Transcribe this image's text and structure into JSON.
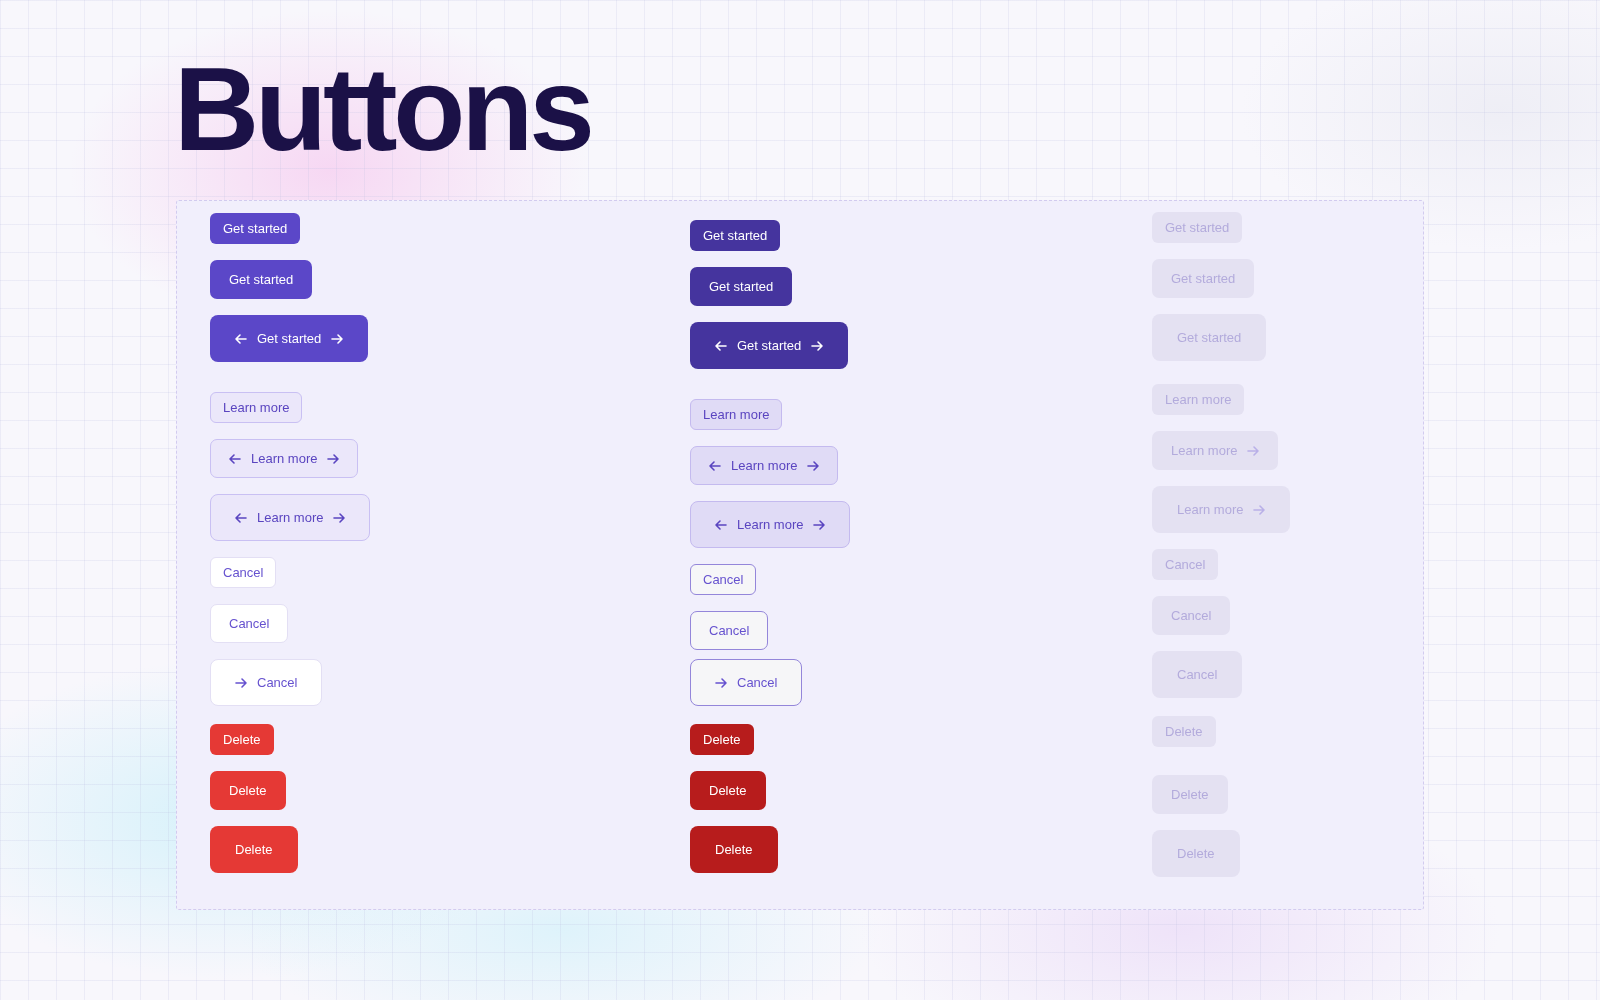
{
  "title": "Buttons",
  "columns": [
    {
      "hovered": false,
      "disabled": false,
      "groups": [
        {
          "kind": "primary",
          "buttons": [
            {
              "kind": "small",
              "label": "Get started",
              "left_arrow_before": false,
              "right_arrow_before": false,
              "right_arrow_after": false
            },
            {
              "kind": "medium",
              "label": "Get started",
              "left_arrow_before": false,
              "right_arrow_before": false,
              "right_arrow_after": false
            },
            {
              "kind": "large",
              "label": "Get started",
              "left_arrow_before": true,
              "right_arrow_before": false,
              "right_arrow_after": true
            }
          ]
        },
        {
          "kind": "secondary",
          "buttons": [
            {
              "kind": "small",
              "label": "Learn more",
              "left_arrow_before": false,
              "right_arrow_before": false,
              "right_arrow_after": false
            },
            {
              "kind": "medium",
              "label": "Learn more",
              "left_arrow_before": true,
              "right_arrow_before": false,
              "right_arrow_after": true
            },
            {
              "kind": "large",
              "label": "Learn more",
              "left_arrow_before": true,
              "right_arrow_before": false,
              "right_arrow_after": true
            }
          ]
        },
        {
          "kind": "outline",
          "buttons": [
            {
              "kind": "small",
              "label": "Cancel",
              "left_arrow_before": false,
              "right_arrow_before": false,
              "right_arrow_after": false
            },
            {
              "kind": "medium",
              "label": "Cancel",
              "left_arrow_before": false,
              "right_arrow_before": false,
              "right_arrow_after": false
            },
            {
              "kind": "large",
              "label": "Cancel",
              "left_arrow_before": false,
              "right_arrow_before": true,
              "right_arrow_after": false
            }
          ]
        },
        {
          "kind": "danger",
          "buttons": [
            {
              "kind": "small",
              "label": "Delete",
              "left_arrow_before": false,
              "right_arrow_before": false,
              "right_arrow_after": false
            },
            {
              "kind": "medium",
              "label": "Delete",
              "left_arrow_before": false,
              "right_arrow_before": false,
              "right_arrow_after": false
            },
            {
              "kind": "large",
              "label": "Delete",
              "left_arrow_before": false,
              "right_arrow_before": false,
              "right_arrow_after": false
            }
          ]
        }
      ]
    },
    {
      "hovered": true,
      "disabled": false,
      "groups": [
        {
          "kind": "primary",
          "buttons": [
            {
              "kind": "small",
              "label": "Get started",
              "left_arrow_before": false,
              "right_arrow_before": false,
              "right_arrow_after": false
            },
            {
              "kind": "medium",
              "label": "Get started",
              "left_arrow_before": false,
              "right_arrow_before": false,
              "right_arrow_after": false
            },
            {
              "kind": "large",
              "label": "Get started",
              "left_arrow_before": true,
              "right_arrow_before": false,
              "right_arrow_after": true
            }
          ]
        },
        {
          "kind": "secondary",
          "buttons": [
            {
              "kind": "small",
              "label": "Learn more",
              "left_arrow_before": false,
              "right_arrow_before": false,
              "right_arrow_after": false
            },
            {
              "kind": "medium",
              "label": "Learn more",
              "left_arrow_before": true,
              "right_arrow_before": false,
              "right_arrow_after": true
            },
            {
              "kind": "large",
              "label": "Learn more",
              "left_arrow_before": true,
              "right_arrow_before": false,
              "right_arrow_after": true
            }
          ]
        },
        {
          "kind": "outline",
          "buttons": [
            {
              "kind": "small",
              "label": "Cancel",
              "left_arrow_before": false,
              "right_arrow_before": false,
              "right_arrow_after": false
            },
            {
              "kind": "medium",
              "label": "Cancel",
              "left_arrow_before": false,
              "right_arrow_before": false,
              "right_arrow_after": false
            },
            {
              "kind": "large",
              "label": "Cancel",
              "left_arrow_before": false,
              "right_arrow_before": true,
              "right_arrow_after": false
            }
          ]
        },
        {
          "kind": "danger",
          "buttons": [
            {
              "kind": "small",
              "label": "Delete",
              "left_arrow_before": false,
              "right_arrow_before": false,
              "right_arrow_after": false
            },
            {
              "kind": "medium",
              "label": "Delete",
              "left_arrow_before": false,
              "right_arrow_before": false,
              "right_arrow_after": false
            },
            {
              "kind": "large",
              "label": "Delete",
              "left_arrow_before": false,
              "right_arrow_before": false,
              "right_arrow_after": false
            }
          ]
        }
      ]
    },
    {
      "hovered": false,
      "disabled": true,
      "groups": [
        {
          "kind": "primary",
          "buttons": [
            {
              "kind": "small",
              "label": "Get started",
              "left_arrow_before": false,
              "right_arrow_before": false,
              "right_arrow_after": false
            },
            {
              "kind": "medium",
              "label": "Get started",
              "left_arrow_before": false,
              "right_arrow_before": false,
              "right_arrow_after": false
            },
            {
              "kind": "large",
              "label": "Get started",
              "left_arrow_before": false,
              "right_arrow_before": false,
              "right_arrow_after": false
            }
          ]
        },
        {
          "kind": "secondary",
          "buttons": [
            {
              "kind": "small",
              "label": "Learn more",
              "left_arrow_before": false,
              "right_arrow_before": false,
              "right_arrow_after": false
            },
            {
              "kind": "medium",
              "label": "Learn more",
              "left_arrow_before": false,
              "right_arrow_before": false,
              "right_arrow_after": true
            },
            {
              "kind": "large",
              "label": "Learn more",
              "left_arrow_before": false,
              "right_arrow_before": false,
              "right_arrow_after": true
            }
          ]
        },
        {
          "kind": "outline",
          "buttons": [
            {
              "kind": "small",
              "label": "Cancel",
              "left_arrow_before": false,
              "right_arrow_before": false,
              "right_arrow_after": false
            },
            {
              "kind": "medium",
              "label": "Cancel",
              "left_arrow_before": false,
              "right_arrow_before": false,
              "right_arrow_after": false
            },
            {
              "kind": "large",
              "label": "Cancel",
              "left_arrow_before": false,
              "right_arrow_before": false,
              "right_arrow_after": false
            }
          ]
        },
        {
          "kind": "danger",
          "buttons": [
            {
              "kind": "small",
              "label": "Delete",
              "left_arrow_before": false,
              "right_arrow_before": false,
              "right_arrow_after": false
            },
            {
              "kind": "medium",
              "label": "Delete",
              "left_arrow_before": false,
              "right_arrow_before": false,
              "right_arrow_after": false
            },
            {
              "kind": "large",
              "label": "Delete",
              "left_arrow_before": false,
              "right_arrow_before": false,
              "right_arrow_after": false
            }
          ]
        }
      ]
    }
  ]
}
